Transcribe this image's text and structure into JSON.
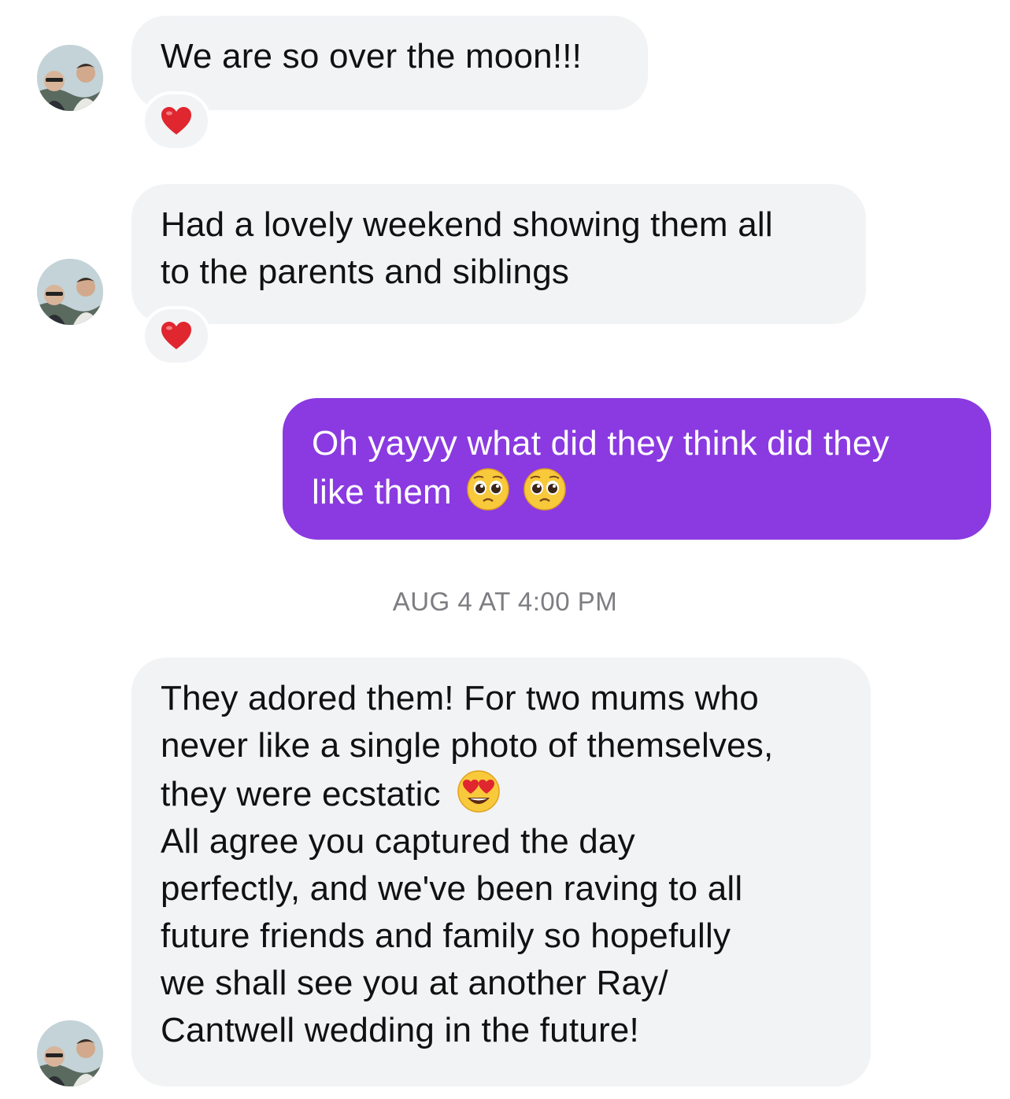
{
  "conversation": {
    "messages": [
      {
        "direction": "incoming",
        "lines": [
          "We are so over the moon!!!"
        ],
        "reaction": "heart-icon"
      },
      {
        "direction": "incoming",
        "lines": [
          "Had a lovely weekend showing them all",
          "to the parents and siblings"
        ],
        "reaction": "heart-icon"
      },
      {
        "direction": "outgoing",
        "lines": [
          "Oh yayyy what did they think did they",
          "like them"
        ],
        "emojis": [
          "pleading-face-icon",
          "pleading-face-icon"
        ]
      },
      {
        "direction": "incoming",
        "lines": [
          "They adored them! For two mums who",
          "never like a single photo of themselves,",
          "they were ecstatic",
          "All agree you captured the day",
          "perfectly, and we've been raving to all",
          "future friends and family so hopefully",
          "we shall see you at another Ray/",
          "Cantwell wedding in the future!"
        ],
        "emojis": [
          "heart-eyes-face-icon"
        ]
      }
    ],
    "timestamp": "AUG 4 AT 4:00 PM"
  },
  "colors": {
    "incoming_bubble": "#f2f3f5",
    "outgoing_bubble": "#8a3ae0",
    "timestamp_text": "#7d7d82",
    "reaction_heart": "#e0262f"
  }
}
